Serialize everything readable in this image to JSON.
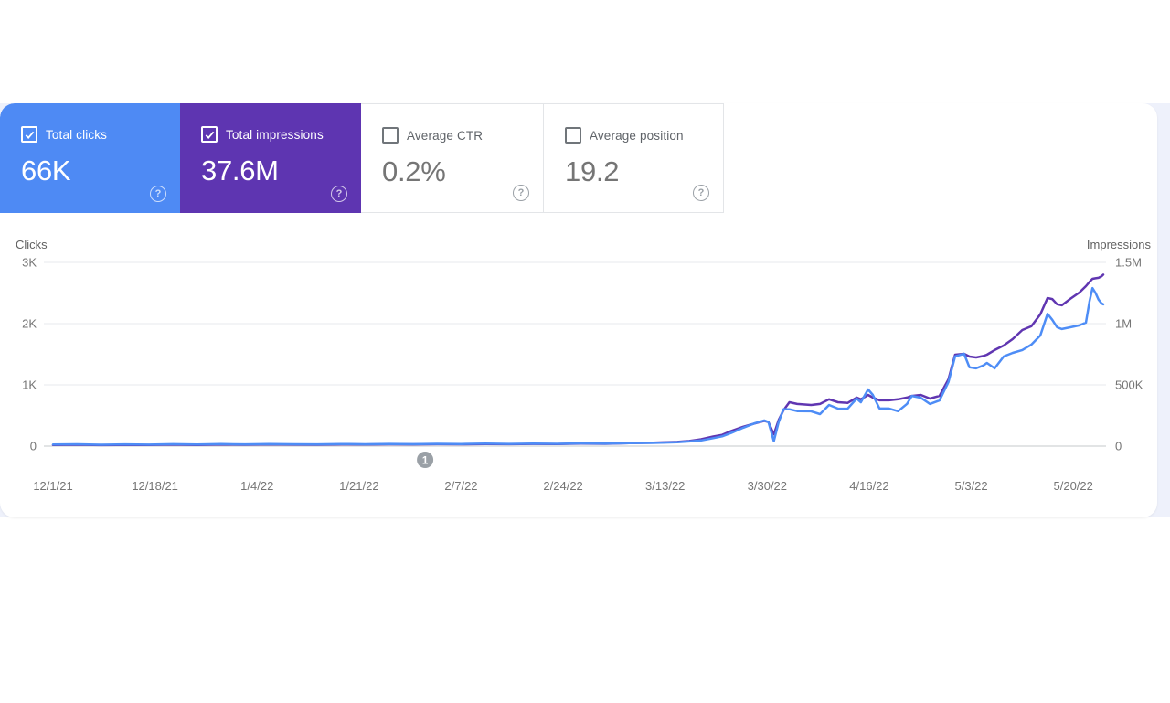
{
  "page": {
    "band_color": "#eef1fb",
    "card_color": "#ffffff"
  },
  "metrics": {
    "help_glyph": "?",
    "cards": [
      {
        "id": "total_clicks",
        "label": "Total clicks",
        "value": "66K",
        "checked": true,
        "bg": "#4e8af4",
        "fg": "#ffffff"
      },
      {
        "id": "total_impressions",
        "label": "Total impressions",
        "value": "37.6M",
        "checked": true,
        "bg": "#5e35b1",
        "fg": "#ffffff"
      },
      {
        "id": "average_ctr",
        "label": "Average CTR",
        "value": "0.2%",
        "checked": false,
        "bg": "#ffffff",
        "fg": "#757575"
      },
      {
        "id": "average_position",
        "label": "Average position",
        "value": "19.2",
        "checked": false,
        "bg": "#ffffff",
        "fg": "#757575"
      }
    ]
  },
  "chart_data": {
    "type": "line",
    "grid": "horizontal",
    "x_tick_labels": [
      "12/1/21",
      "12/18/21",
      "1/4/22",
      "1/21/22",
      "2/7/22",
      "2/24/22",
      "3/13/22",
      "3/30/22",
      "4/16/22",
      "5/3/22",
      "5/20/22"
    ],
    "x_tick_interval_days": 17,
    "x_range_days": [
      0,
      175
    ],
    "left_axis": {
      "label": "Clicks",
      "ticks": [
        "0",
        "1K",
        "2K",
        "3K"
      ],
      "range": [
        0,
        3000
      ]
    },
    "right_axis": {
      "label": "Impressions",
      "ticks": [
        "0",
        "500K",
        "1M",
        "1.5M"
      ],
      "range": [
        0,
        1500000
      ]
    },
    "annotations": [
      {
        "label": "1",
        "day": 62
      }
    ],
    "series": [
      {
        "name": "Total impressions",
        "axis": "right",
        "color": "#6036b1",
        "points": [
          [
            0,
            9000
          ],
          [
            4,
            11000
          ],
          [
            8,
            8000
          ],
          [
            12,
            10000
          ],
          [
            16,
            9000
          ],
          [
            20,
            12000
          ],
          [
            24,
            10000
          ],
          [
            28,
            13000
          ],
          [
            32,
            11000
          ],
          [
            36,
            14000
          ],
          [
            40,
            12000
          ],
          [
            44,
            11000
          ],
          [
            48,
            14000
          ],
          [
            52,
            13000
          ],
          [
            56,
            15000
          ],
          [
            60,
            14000
          ],
          [
            64,
            16000
          ],
          [
            68,
            15000
          ],
          [
            72,
            17000
          ],
          [
            76,
            16000
          ],
          [
            80,
            18000
          ],
          [
            84,
            17000
          ],
          [
            88,
            20000
          ],
          [
            92,
            19000
          ],
          [
            96,
            24000
          ],
          [
            100,
            28000
          ],
          [
            104,
            34000
          ],
          [
            106,
            42000
          ],
          [
            108,
            56000
          ],
          [
            110,
            78000
          ],
          [
            111.5,
            92000
          ],
          [
            113,
            124000
          ],
          [
            115,
            158000
          ],
          [
            117,
            186000
          ],
          [
            118.5,
            206000
          ],
          [
            119.2,
            196000
          ],
          [
            120.1,
            96000
          ],
          [
            120.9,
            212000
          ],
          [
            121.7,
            292000
          ],
          [
            122.7,
            358000
          ],
          [
            124,
            344000
          ],
          [
            126.3,
            336000
          ],
          [
            127.8,
            344000
          ],
          [
            129.3,
            382000
          ],
          [
            130.8,
            358000
          ],
          [
            132.4,
            352000
          ],
          [
            133.9,
            396000
          ],
          [
            134.6,
            382000
          ],
          [
            135.8,
            418000
          ],
          [
            136.6,
            396000
          ],
          [
            137.7,
            374000
          ],
          [
            139.3,
            374000
          ],
          [
            140.8,
            382000
          ],
          [
            142.3,
            396000
          ],
          [
            143.1,
            410000
          ],
          [
            144.6,
            418000
          ],
          [
            146.1,
            388000
          ],
          [
            147.7,
            410000
          ],
          [
            149.2,
            545000
          ],
          [
            150.3,
            746000
          ],
          [
            151.8,
            754000
          ],
          [
            152.7,
            731000
          ],
          [
            153.8,
            724000
          ],
          [
            155,
            736000
          ],
          [
            155.6,
            746000
          ],
          [
            156.9,
            784000
          ],
          [
            158.4,
            822000
          ],
          [
            159.9,
            874000
          ],
          [
            161.5,
            948000
          ],
          [
            163,
            978000
          ],
          [
            164.5,
            1075000
          ],
          [
            165.7,
            1209000
          ],
          [
            166.5,
            1201000
          ],
          [
            167.3,
            1158000
          ],
          [
            168.1,
            1150000
          ],
          [
            169.5,
            1202000
          ],
          [
            171,
            1254000
          ],
          [
            172.1,
            1306000
          ],
          [
            172.7,
            1340000
          ],
          [
            173.2,
            1366000
          ],
          [
            173.7,
            1370000
          ],
          [
            174.2,
            1374000
          ],
          [
            174.7,
            1386000
          ],
          [
            175,
            1400000
          ]
        ]
      },
      {
        "name": "Total clicks",
        "axis": "left",
        "color": "#4e8df6",
        "points": [
          [
            0,
            25
          ],
          [
            4,
            30
          ],
          [
            8,
            22
          ],
          [
            12,
            28
          ],
          [
            16,
            24
          ],
          [
            20,
            31
          ],
          [
            24,
            26
          ],
          [
            28,
            33
          ],
          [
            32,
            28
          ],
          [
            36,
            35
          ],
          [
            40,
            30
          ],
          [
            44,
            28
          ],
          [
            48,
            34
          ],
          [
            52,
            30
          ],
          [
            56,
            36
          ],
          [
            60,
            32
          ],
          [
            64,
            38
          ],
          [
            68,
            34
          ],
          [
            72,
            40
          ],
          [
            76,
            36
          ],
          [
            80,
            42
          ],
          [
            84,
            38
          ],
          [
            88,
            45
          ],
          [
            92,
            41
          ],
          [
            96,
            48
          ],
          [
            100,
            52
          ],
          [
            104,
            62
          ],
          [
            106,
            76
          ],
          [
            108,
            92
          ],
          [
            110,
            130
          ],
          [
            111.5,
            160
          ],
          [
            113,
            215
          ],
          [
            115,
            300
          ],
          [
            117,
            376
          ],
          [
            118.5,
            420
          ],
          [
            119.2,
            392
          ],
          [
            120.1,
            80
          ],
          [
            120.9,
            390
          ],
          [
            121.7,
            600
          ],
          [
            122.7,
            602
          ],
          [
            124,
            572
          ],
          [
            126.3,
            568
          ],
          [
            127.8,
            522
          ],
          [
            129.3,
            672
          ],
          [
            130.8,
            612
          ],
          [
            132.4,
            610
          ],
          [
            133.9,
            776
          ],
          [
            134.6,
            716
          ],
          [
            135.8,
            926
          ],
          [
            136.6,
            836
          ],
          [
            137.7,
            616
          ],
          [
            139.3,
            614
          ],
          [
            140.8,
            570
          ],
          [
            142.3,
            690
          ],
          [
            143.1,
            820
          ],
          [
            144.6,
            790
          ],
          [
            146.1,
            688
          ],
          [
            147.7,
            745
          ],
          [
            149.2,
            1045
          ],
          [
            150.3,
            1465
          ],
          [
            151.8,
            1508
          ],
          [
            152.7,
            1286
          ],
          [
            153.8,
            1270
          ],
          [
            155,
            1316
          ],
          [
            155.6,
            1358
          ],
          [
            156.9,
            1270
          ],
          [
            158.4,
            1464
          ],
          [
            159.9,
            1522
          ],
          [
            161.5,
            1568
          ],
          [
            163,
            1656
          ],
          [
            164.5,
            1806
          ],
          [
            165.7,
            2160
          ],
          [
            166.5,
            2062
          ],
          [
            167.3,
            1940
          ],
          [
            168.1,
            1912
          ],
          [
            169.5,
            1940
          ],
          [
            171,
            1972
          ],
          [
            172.1,
            2016
          ],
          [
            172.7,
            2360
          ],
          [
            173.2,
            2580
          ],
          [
            173.7,
            2502
          ],
          [
            174.2,
            2392
          ],
          [
            174.7,
            2330
          ],
          [
            175,
            2315
          ]
        ]
      }
    ],
    "colors": {
      "gridline": "#e7e9ec",
      "baseline": "#c6c8cb",
      "annotation_marker": "#9aa0a6",
      "tick_text": "#757575"
    }
  }
}
